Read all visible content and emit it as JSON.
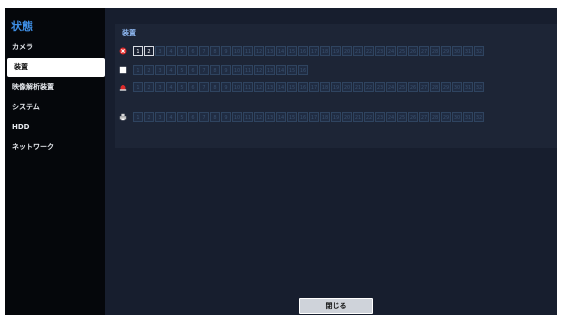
{
  "sidebar": {
    "title": "状態",
    "items": [
      {
        "label": "カメラ"
      },
      {
        "label": "装置"
      },
      {
        "label": "映像解析装置"
      },
      {
        "label": "システム"
      },
      {
        "label": "HDD"
      },
      {
        "label": "ネットワーク"
      }
    ],
    "selected_index": 1
  },
  "main": {
    "title": "装置",
    "rows": [
      {
        "icon": "alarm-in-icon",
        "count": 32,
        "active": [
          1,
          2
        ]
      },
      {
        "icon": "alarm-out-icon",
        "count": 16,
        "active": []
      },
      {
        "icon": "alert-light-icon",
        "count": 32,
        "active": []
      },
      {
        "icon": "printer-icon",
        "count": 32,
        "active": []
      }
    ]
  },
  "footer": {
    "close_label": "閉じる"
  }
}
